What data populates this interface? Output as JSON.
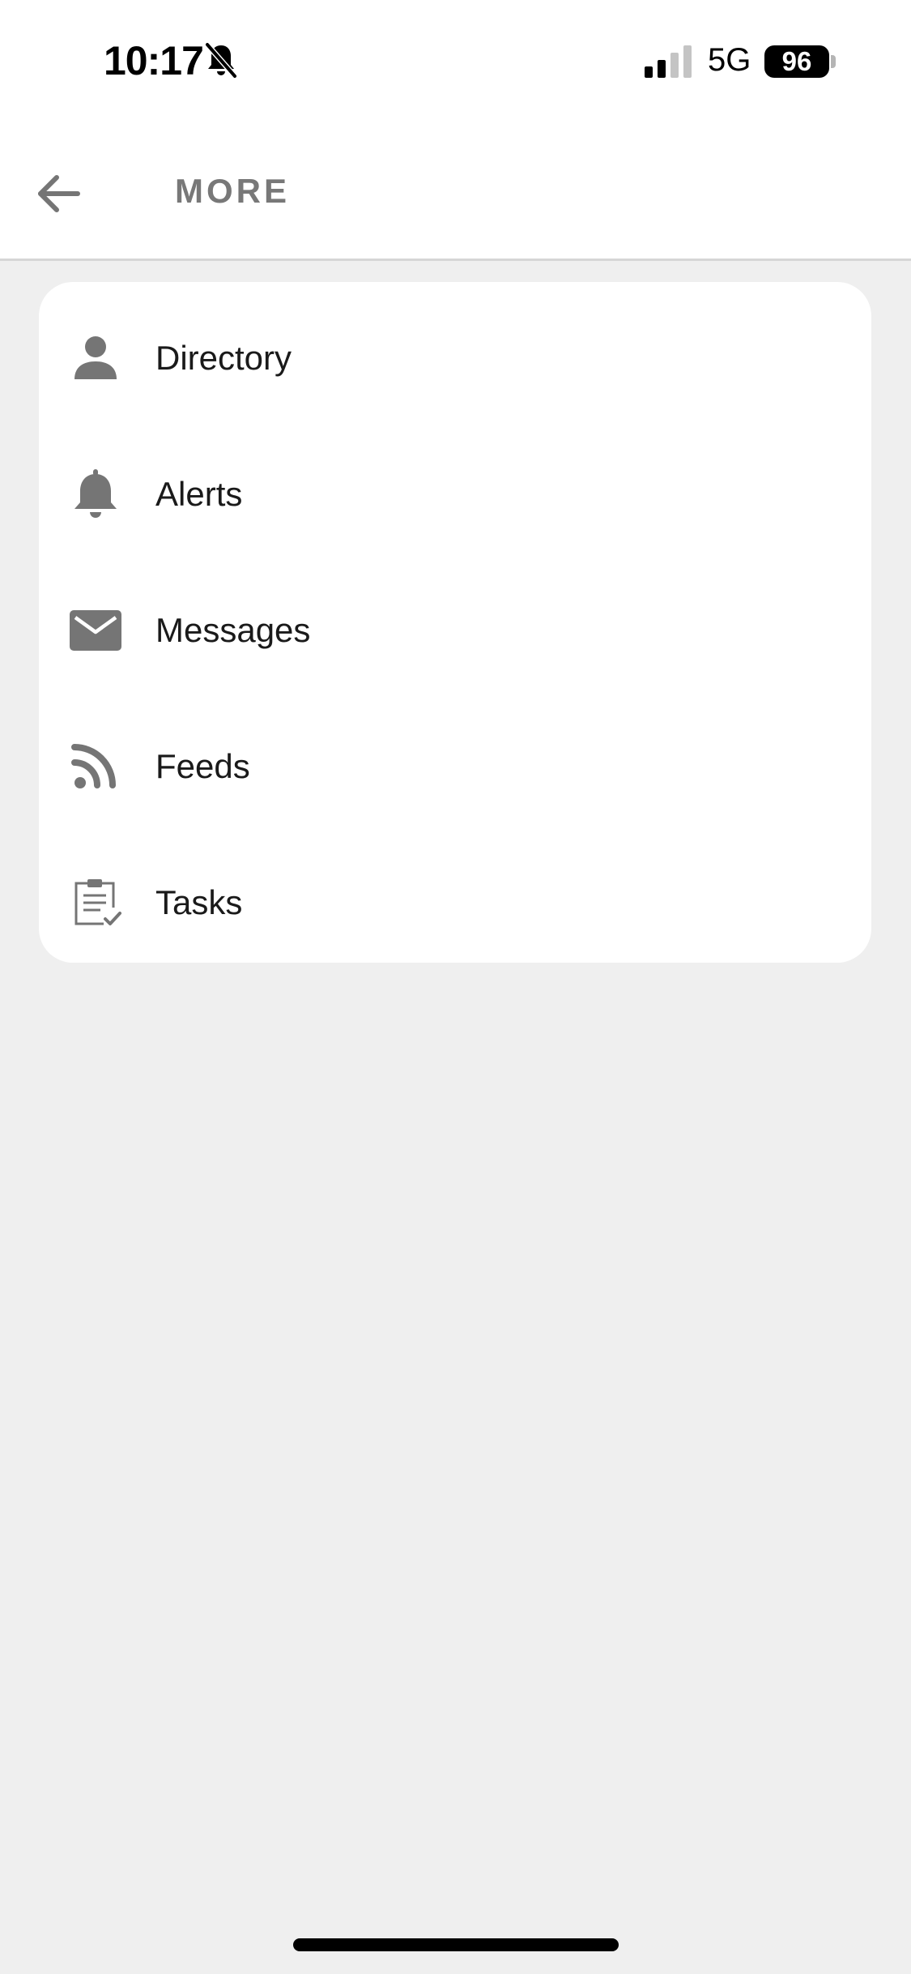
{
  "status_bar": {
    "time": "10:17",
    "network": "5G",
    "battery": "96"
  },
  "header": {
    "title": "MORE"
  },
  "menu": {
    "items": [
      {
        "label": "Directory",
        "icon": "person-icon"
      },
      {
        "label": "Alerts",
        "icon": "bell-icon"
      },
      {
        "label": "Messages",
        "icon": "envelope-icon"
      },
      {
        "label": "Feeds",
        "icon": "rss-icon"
      },
      {
        "label": "Tasks",
        "icon": "clipboard-check-icon"
      }
    ]
  },
  "colors": {
    "background": "#efefef",
    "icon": "#757575",
    "title": "#787878",
    "text": "#1a1a1a"
  }
}
